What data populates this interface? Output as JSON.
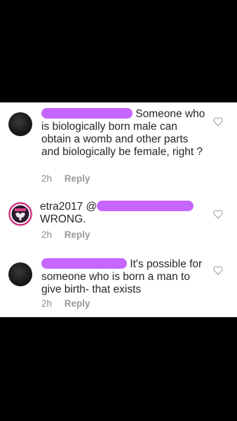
{
  "comments": [
    {
      "username": "",
      "text": "Someone who is biologically born male can obtain a womb and other parts and biologically be female, right ?",
      "time": "2h",
      "reply_label": "Reply"
    },
    {
      "username": "etra2017",
      "mention_prefix": "@",
      "text": "WRONG.",
      "time": "2h",
      "reply_label": "Reply"
    },
    {
      "username": "",
      "text": "It's possible for someone who is born a man to give birth- that exists",
      "time": "2h",
      "reply_label": "Reply"
    }
  ],
  "colors": {
    "redaction": "#c766ff",
    "text": "#262626",
    "meta": "#8e8e8e",
    "logo_ring": "#d4247a"
  },
  "icons": [
    "avatar-photo",
    "logo-avatar",
    "heart-outline-icon"
  ]
}
